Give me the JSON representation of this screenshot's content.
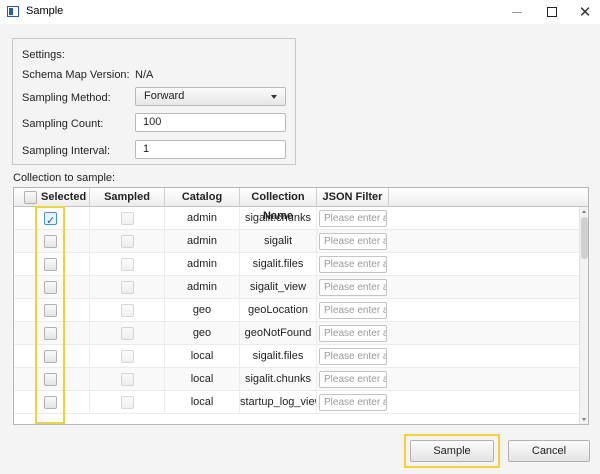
{
  "window": {
    "title": "Sample"
  },
  "settings": {
    "heading": "Settings:",
    "schema_map_version_label": "Schema Map Version:",
    "schema_map_version_value": "N/A",
    "sampling_method_label": "Sampling Method:",
    "sampling_method_value": "Forward",
    "sampling_count_label": "Sampling Count:",
    "sampling_count_value": "100",
    "sampling_interval_label": "Sampling Interval:",
    "sampling_interval_value": "1"
  },
  "collections": {
    "label": "Collection to sample:",
    "columns": [
      "Selected",
      "Sampled",
      "Catalog",
      "Collection Name",
      "JSON Filter"
    ],
    "filter_placeholder": "Please enter a v",
    "rows": [
      {
        "selected": true,
        "sampled": false,
        "catalog": "admin",
        "collection": "sigalit.chunks"
      },
      {
        "selected": false,
        "sampled": false,
        "catalog": "admin",
        "collection": "sigalit"
      },
      {
        "selected": false,
        "sampled": false,
        "catalog": "admin",
        "collection": "sigalit.files"
      },
      {
        "selected": false,
        "sampled": false,
        "catalog": "admin",
        "collection": "sigalit_view"
      },
      {
        "selected": false,
        "sampled": false,
        "catalog": "geo",
        "collection": "geoLocation"
      },
      {
        "selected": false,
        "sampled": false,
        "catalog": "geo",
        "collection": "geoNotFound"
      },
      {
        "selected": false,
        "sampled": false,
        "catalog": "local",
        "collection": "sigalit.files"
      },
      {
        "selected": false,
        "sampled": false,
        "catalog": "local",
        "collection": "sigalit.chunks"
      },
      {
        "selected": false,
        "sampled": false,
        "catalog": "local",
        "collection": "startup_log_view"
      }
    ]
  },
  "buttons": {
    "sample": "Sample",
    "cancel": "Cancel"
  },
  "icons": {
    "app": "window-app-icon",
    "minimize": "minimize-icon",
    "maximize": "maximize-icon",
    "close": "close-icon"
  },
  "colors": {
    "highlight": "#f4d03f",
    "check": "#1d5fa8"
  }
}
